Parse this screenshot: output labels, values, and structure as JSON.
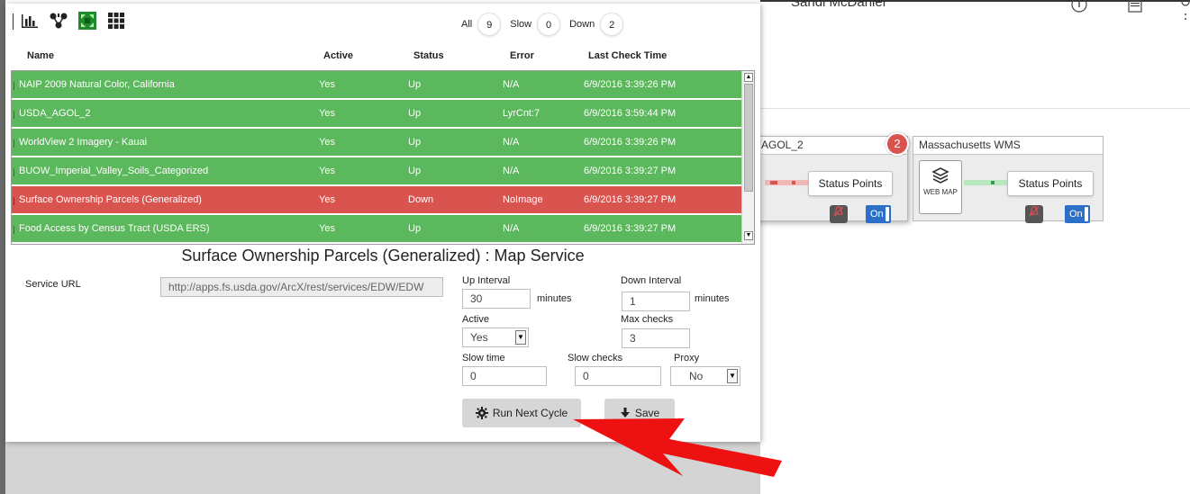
{
  "background": {
    "user_name": "Sandi McDaniel",
    "cards": [
      {
        "title": "AGOL_2",
        "status_button": "Status Points",
        "toggle": "On",
        "badge": "2"
      },
      {
        "title": "Massachusetts WMS",
        "icon_text": "WEB MAP",
        "status_button": "Status Points",
        "toggle": "On"
      }
    ]
  },
  "counters": {
    "all_label": "All",
    "all_count": "9",
    "slow_label": "Slow",
    "slow_count": "0",
    "down_label": "Down",
    "down_count": "2"
  },
  "table": {
    "headers": {
      "name": "Name",
      "active": "Active",
      "status": "Status",
      "error": "Error",
      "last_check": "Last Check Time"
    },
    "rows": [
      {
        "name": "NAIP 2009 Natural Color, California",
        "active": "Yes",
        "status": "Up",
        "error": "N/A",
        "time": "6/9/2016 3:39:26 PM"
      },
      {
        "name": "USDA_AGOL_2",
        "active": "Yes",
        "status": "Up",
        "error": "LyrCnt:7",
        "time": "6/9/2016 3:59:44 PM"
      },
      {
        "name": "WorldView 2 Imagery - Kauai",
        "active": "Yes",
        "status": "Up",
        "error": "N/A",
        "time": "6/9/2016 3:39:26 PM"
      },
      {
        "name": "BUOW_Imperial_Valley_Soils_Categorized",
        "active": "Yes",
        "status": "Up",
        "error": "N/A",
        "time": "6/9/2016 3:39:27 PM"
      },
      {
        "name": "Surface Ownership Parcels (Generalized)",
        "active": "Yes",
        "status": "Down",
        "error": "NoImage",
        "time": "6/9/2016 3:39:27 PM"
      },
      {
        "name": "Food Access by Census Tract (USDA ERS)",
        "active": "Yes",
        "status": "Up",
        "error": "N/A",
        "time": "6/9/2016 3:39:27 PM"
      }
    ]
  },
  "detail": {
    "title": "Surface Ownership Parcels (Generalized) : Map Service",
    "service_url_label": "Service URL",
    "service_url": "http://apps.fs.usda.gov/ArcX/rest/services/EDW/EDW",
    "up_interval_label": "Up Interval",
    "up_interval": "30",
    "down_interval_label": "Down Interval",
    "down_interval": "1",
    "minutes_label": "minutes",
    "active_label": "Active",
    "active_value": "Yes",
    "max_checks_label": "Max checks",
    "max_checks": "3",
    "slow_time_label": "Slow time",
    "slow_time": "0",
    "slow_checks_label": "Slow checks",
    "slow_checks": "0",
    "proxy_label": "Proxy",
    "proxy_value": "No",
    "run_button": "Run Next Cycle",
    "save_button": "Save"
  },
  "colors": {
    "up": "#5cb85c",
    "down": "#d9534f",
    "accent": "#2c6fc9",
    "annotation_arrow": "#ee1111"
  }
}
